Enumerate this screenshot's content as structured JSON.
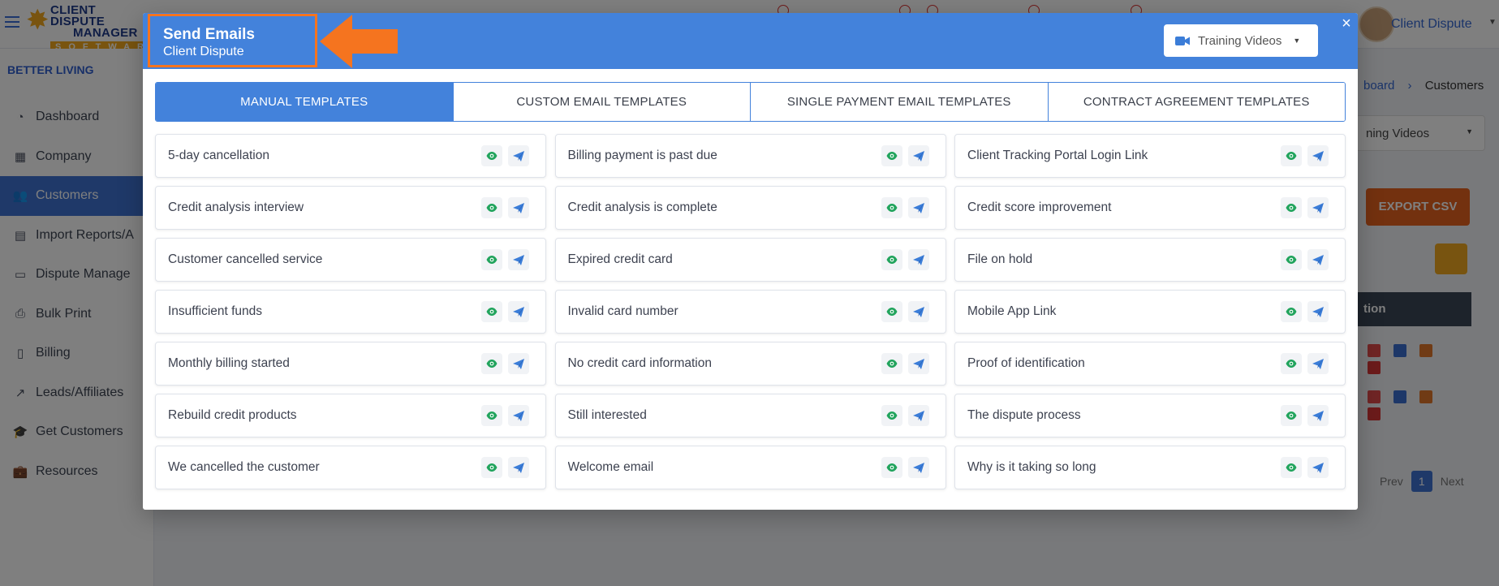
{
  "background": {
    "brand": "BETTER LIVING",
    "logo": {
      "top": "CLIENT DISPUTE",
      "middle": "MANAGER",
      "bottom": "SOFTWARE"
    },
    "user": {
      "name": "Client Dispute"
    },
    "sidebar": {
      "items": [
        {
          "label": "Dashboard",
          "icon": "dashboard-icon"
        },
        {
          "label": "Company",
          "icon": "building-icon"
        },
        {
          "label": "Customers",
          "icon": "users-icon",
          "active": true
        },
        {
          "label": "Import Reports/A",
          "icon": "file-import-icon"
        },
        {
          "label": "Dispute Manage",
          "icon": "laptop-icon"
        },
        {
          "label": "Bulk Print",
          "icon": "printer-icon"
        },
        {
          "label": "Billing",
          "icon": "invoice-icon"
        },
        {
          "label": "Leads/Affiliates",
          "icon": "chart-line-icon"
        },
        {
          "label": "Get Customers",
          "icon": "graduation-cap-icon"
        },
        {
          "label": "Resources",
          "icon": "briefcase-icon"
        }
      ]
    },
    "breadcrumb": {
      "prev": "board",
      "current": "Customers"
    },
    "training_videos_label": "ning Videos",
    "export_label": "EXPORT CSV",
    "table_header": "tion",
    "pager": {
      "prev": "Prev",
      "page": "1",
      "next": "Next"
    }
  },
  "modal": {
    "title": "Send Emails",
    "subtitle": "Client Dispute",
    "close_label": "×",
    "training_button_label": "Training Videos",
    "tabs": [
      {
        "label": "MANUAL TEMPLATES",
        "active": true
      },
      {
        "label": "CUSTOM EMAIL TEMPLATES",
        "active": false
      },
      {
        "label": "SINGLE PAYMENT EMAIL TEMPLATES",
        "active": false
      },
      {
        "label": "CONTRACT AGREEMENT TEMPLATES",
        "active": false
      }
    ],
    "templates": [
      "5-day cancellation",
      "Billing payment is past due",
      "Client Tracking Portal Login Link",
      "Credit analysis interview",
      "Credit analysis is complete",
      "Credit score improvement",
      "Customer cancelled service",
      "Expired credit card",
      "File on hold",
      "Insufficient funds",
      "Invalid card number",
      "Mobile App Link",
      "Monthly billing started",
      "No credit card information",
      "Proof of identification",
      "Rebuild credit products",
      "Still interested",
      "The dispute process",
      "We cancelled the customer",
      "Welcome email",
      "Why is it taking so long"
    ]
  },
  "colors": {
    "primary": "#4382db",
    "highlight_orange": "#f5741f",
    "preview_green": "#22a45d",
    "send_blue": "#3b7dd8",
    "export_orange": "#e6621f"
  }
}
